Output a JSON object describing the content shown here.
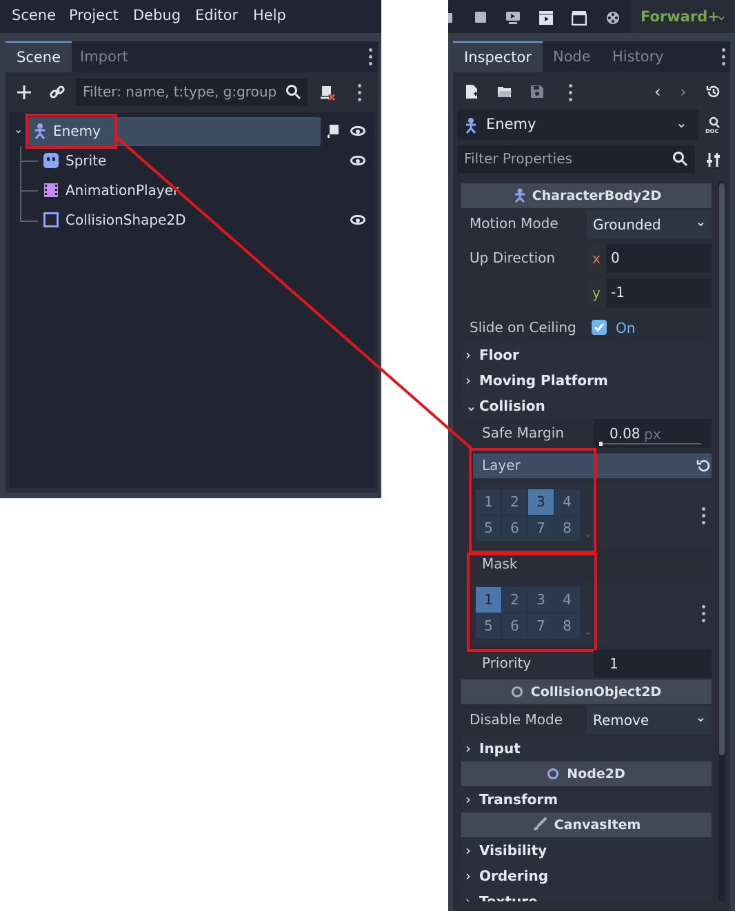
{
  "menu": [
    "Scene",
    "Project",
    "Debug",
    "Editor",
    "Help"
  ],
  "scene_dock": {
    "tabs": [
      "Scene",
      "Import"
    ],
    "filter_placeholder": "Filter: name, t:type, g:group",
    "nodes": [
      {
        "name": "Enemy",
        "icon": "character-body-icon"
      },
      {
        "name": "Sprite",
        "icon": "sprite-icon"
      },
      {
        "name": "AnimationPlayer",
        "icon": "animation-player-icon"
      },
      {
        "name": "CollisionShape2D",
        "icon": "collision-shape-icon"
      }
    ]
  },
  "toolbar": {
    "renderer": "Forward+"
  },
  "inspector": {
    "tabs": [
      "Inspector",
      "Node",
      "History"
    ],
    "object_name": "Enemy",
    "filter_placeholder": "Filter Properties",
    "class_header": "CharacterBody2D",
    "motion_mode": {
      "label": "Motion Mode",
      "value": "Grounded"
    },
    "up_direction": {
      "label": "Up Direction",
      "x_label": "x",
      "x": "0",
      "y_label": "y",
      "y": "-1"
    },
    "slide_on_ceiling": {
      "label": "Slide on Ceiling",
      "value": "On"
    },
    "groups": {
      "floor": "Floor",
      "moving_platform": "Moving Platform",
      "collision": "Collision"
    },
    "safe_margin": {
      "label": "Safe Margin",
      "value": "0.08",
      "unit": "px"
    },
    "layer": {
      "label": "Layer",
      "bits": [
        "1",
        "2",
        "3",
        "4",
        "5",
        "6",
        "7",
        "8"
      ],
      "active": [
        3
      ]
    },
    "mask": {
      "label": "Mask",
      "bits": [
        "1",
        "2",
        "3",
        "4",
        "5",
        "6",
        "7",
        "8"
      ],
      "active": [
        1
      ]
    },
    "priority": {
      "label": "Priority",
      "value": "1"
    },
    "collision_object_header": "CollisionObject2D",
    "disable_mode": {
      "label": "Disable Mode",
      "value": "Remove"
    },
    "input_group": "Input",
    "node2d_header": "Node2D",
    "transform_group": "Transform",
    "canvasitem_header": "CanvasItem",
    "visibility_group": "Visibility",
    "ordering_group": "Ordering",
    "texture_group": "Texture"
  }
}
